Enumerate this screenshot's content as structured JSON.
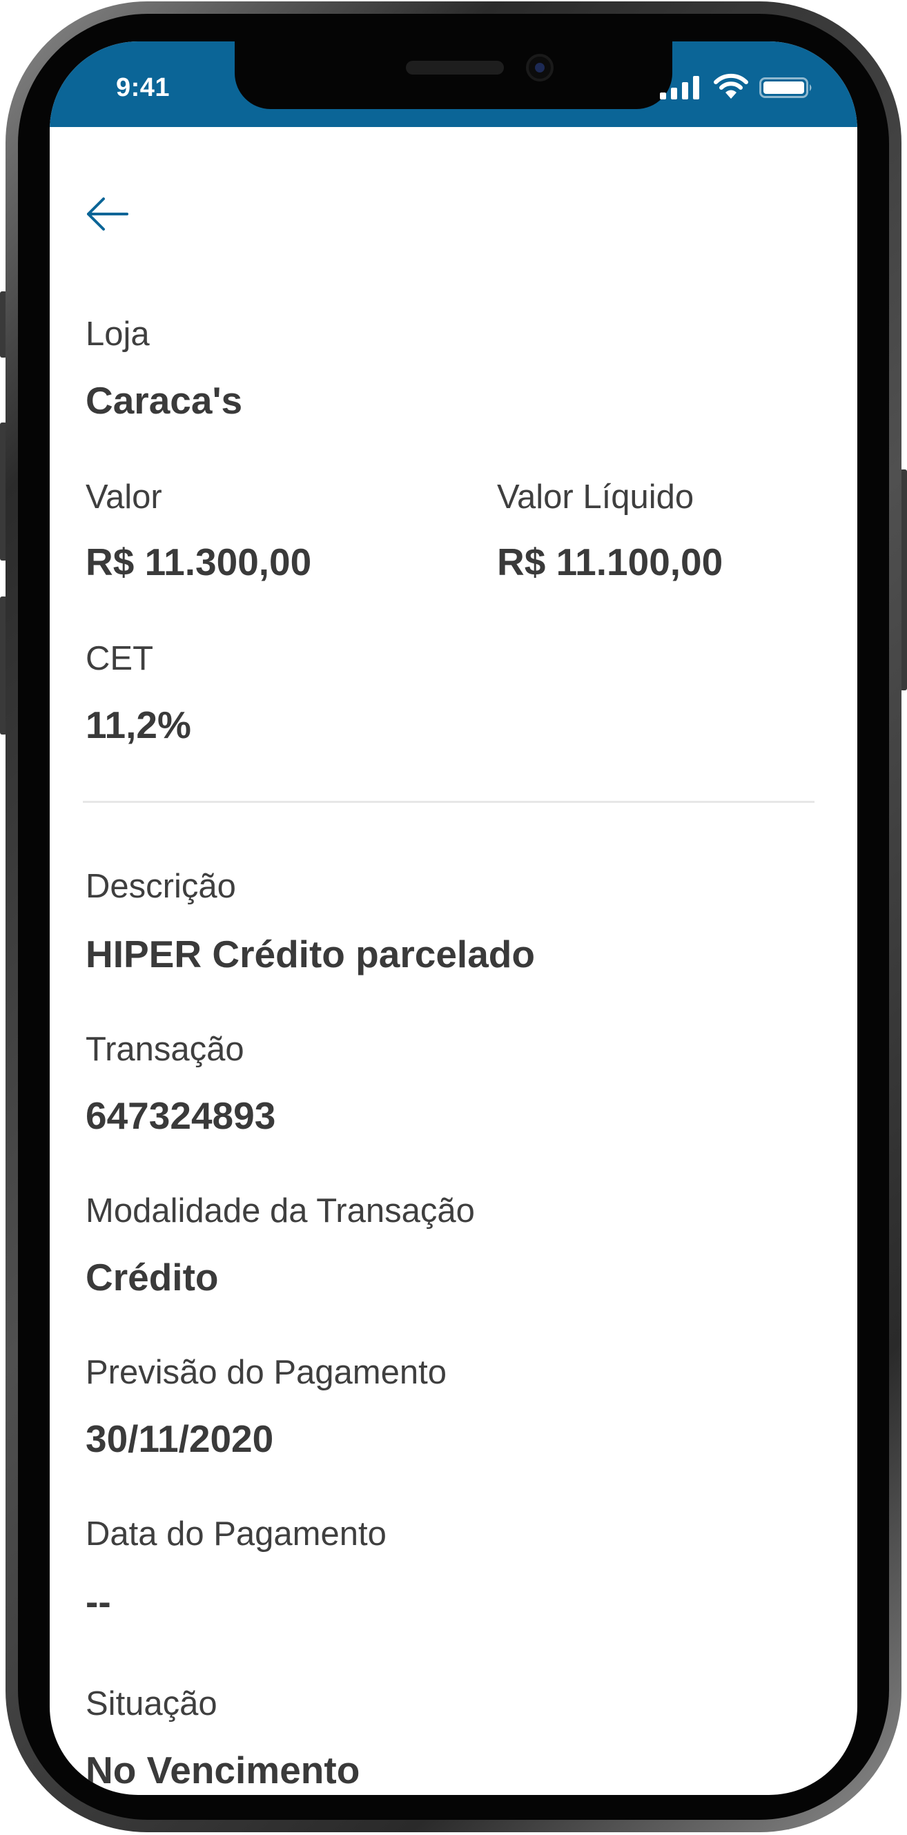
{
  "status_bar": {
    "time": "9:41",
    "background": "#0b6597"
  },
  "navigation": {
    "back_icon": "arrow-left-icon"
  },
  "details": {
    "loja": {
      "label": "Loja",
      "value": "Caraca's"
    },
    "valor": {
      "label": "Valor",
      "value": "R$ 11.300,00"
    },
    "valor_liquido": {
      "label": "Valor Líquido",
      "value": "R$ 11.100,00"
    },
    "cet": {
      "label": "CET",
      "value": "11,2%"
    },
    "descricao": {
      "label": "Descrição",
      "value": "HIPER Crédito parcelado"
    },
    "transacao": {
      "label": "Transação",
      "value": "647324893"
    },
    "modalidade": {
      "label": "Modalidade da Transação",
      "value": "Crédito"
    },
    "previsao": {
      "label": "Previsão do Pagamento",
      "value": "30/11/2020"
    },
    "data_pagamento": {
      "label": "Data do Pagamento",
      "value": "--"
    },
    "situacao": {
      "label": "Situação",
      "value": "No Vencimento"
    }
  },
  "colors": {
    "accent": "#0b6597",
    "label_text": "#3f3f3f",
    "value_text": "#3a3a3a",
    "divider": "#e7e7e7"
  }
}
